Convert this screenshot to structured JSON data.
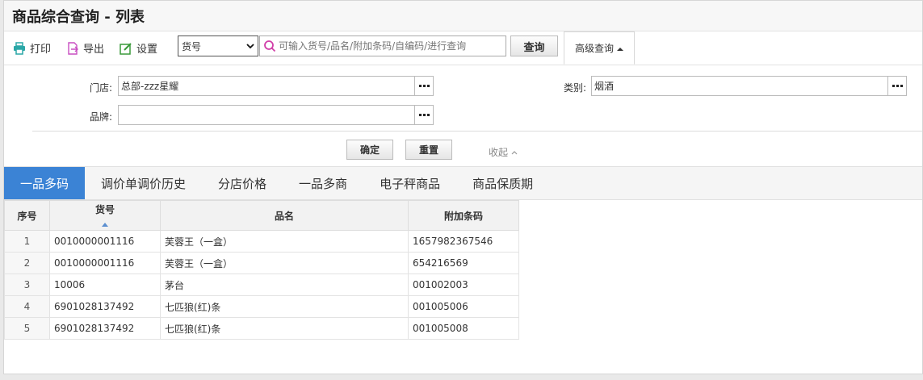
{
  "page": {
    "title": "商品综合查询 - 列表"
  },
  "toolbar": {
    "print_label": "打印",
    "export_label": "导出",
    "settings_label": "设置",
    "search_type_value": "货号",
    "search_placeholder": "可输入货号/品名/附加条码/自编码/进行查询",
    "query_label": "查询",
    "advanced_label": "高级查询"
  },
  "filter": {
    "store_label": "门店:",
    "store_value": "总部-zzz星耀",
    "category_label": "类别:",
    "category_value": "烟酒",
    "brand_label": "品牌:",
    "brand_value": "",
    "confirm_label": "确定",
    "reset_label": "重置",
    "collapse_label": "收起"
  },
  "tabs": [
    {
      "label": "一品多码"
    },
    {
      "label": "调价单调价历史"
    },
    {
      "label": "分店价格"
    },
    {
      "label": "一品多商"
    },
    {
      "label": "电子秤商品"
    },
    {
      "label": "商品保质期"
    }
  ],
  "table": {
    "headers": [
      "序号",
      "货号",
      "品名",
      "附加条码"
    ],
    "rows": [
      [
        "1",
        "0010000001116",
        "芙蓉王（一盒）",
        "1657982367546"
      ],
      [
        "2",
        "0010000001116",
        "芙蓉王（一盒）",
        "654216569"
      ],
      [
        "3",
        "10006",
        "茅台",
        "001002003"
      ],
      [
        "4",
        "6901028137492",
        "七匹狼(红)条",
        "001005006"
      ],
      [
        "5",
        "6901028137492",
        "七匹狼(红)条",
        "001005008"
      ]
    ]
  },
  "colors": {
    "accent": "#3b83d5",
    "print_icon": "#2aa7a7",
    "export_icon": "#c94fc2",
    "settings_icon": "#3a9a3a"
  }
}
